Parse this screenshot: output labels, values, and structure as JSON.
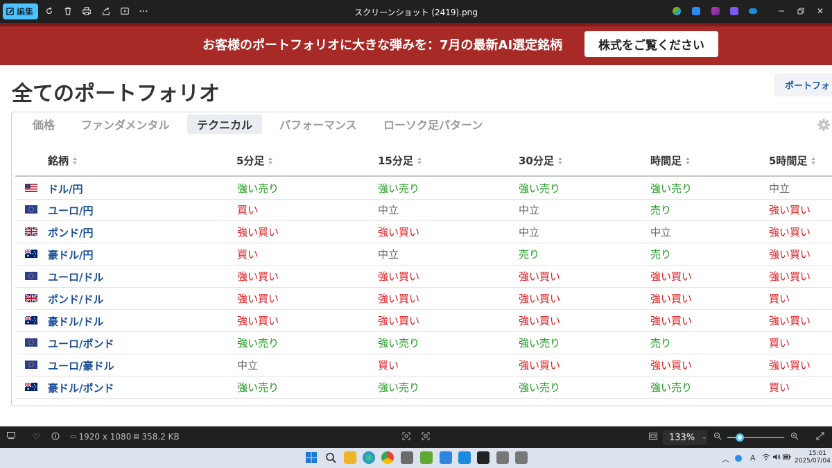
{
  "window": {
    "title": "スクリーンショット (2419).png",
    "edit_label": "編集",
    "toolbar_icons": [
      "rotate-icon",
      "delete-icon",
      "print-icon",
      "share-icon",
      "slideshow-icon",
      "more-icon"
    ],
    "window_controls": [
      "minimize-icon",
      "restore-icon",
      "close-icon"
    ]
  },
  "banner": {
    "text": "お客様のポートフォリオに大きな弾みを：7月の最新AI選定銘柄",
    "cta_label": "株式をご覧ください",
    "background_color": "#a72a27"
  },
  "page": {
    "title": "全てのポートフォリオ",
    "right_button_label": "ポートフォ"
  },
  "tabs": [
    {
      "label": "価格",
      "active": false
    },
    {
      "label": "ファンダメンタル",
      "active": false
    },
    {
      "label": "テクニカル",
      "active": true
    },
    {
      "label": "パフォーマンス",
      "active": false
    },
    {
      "label": "ローソク足パターン",
      "active": false
    }
  ],
  "table": {
    "columns": [
      "銘柄",
      "5分足",
      "15分足",
      "30分足",
      "時間足",
      "5時間足"
    ],
    "signal_colors": {
      "sell": "#1e9b1e",
      "buy": "#e0191c",
      "neutral": "#666666"
    },
    "rows": [
      {
        "flag": "us",
        "pair": "ドル/円",
        "signals": [
          {
            "text": "強い売り",
            "kind": "sell"
          },
          {
            "text": "強い売り",
            "kind": "sell"
          },
          {
            "text": "強い売り",
            "kind": "sell"
          },
          {
            "text": "強い売り",
            "kind": "sell"
          },
          {
            "text": "中立",
            "kind": "neutral"
          }
        ]
      },
      {
        "flag": "eu",
        "pair": "ユーロ/円",
        "signals": [
          {
            "text": "買い",
            "kind": "buy"
          },
          {
            "text": "中立",
            "kind": "neutral"
          },
          {
            "text": "中立",
            "kind": "neutral"
          },
          {
            "text": "売り",
            "kind": "sell"
          },
          {
            "text": "強い買い",
            "kind": "buy"
          }
        ]
      },
      {
        "flag": "gb",
        "pair": "ポンド/円",
        "signals": [
          {
            "text": "強い買い",
            "kind": "buy"
          },
          {
            "text": "強い買い",
            "kind": "buy"
          },
          {
            "text": "中立",
            "kind": "neutral"
          },
          {
            "text": "中立",
            "kind": "neutral"
          },
          {
            "text": "強い買い",
            "kind": "buy"
          }
        ]
      },
      {
        "flag": "au",
        "pair": "豪ドル/円",
        "signals": [
          {
            "text": "買い",
            "kind": "buy"
          },
          {
            "text": "中立",
            "kind": "neutral"
          },
          {
            "text": "売り",
            "kind": "sell"
          },
          {
            "text": "売り",
            "kind": "sell"
          },
          {
            "text": "強い買い",
            "kind": "buy"
          }
        ]
      },
      {
        "flag": "eu",
        "pair": "ユーロ/ドル",
        "signals": [
          {
            "text": "強い買い",
            "kind": "buy"
          },
          {
            "text": "強い買い",
            "kind": "buy"
          },
          {
            "text": "強い買い",
            "kind": "buy"
          },
          {
            "text": "強い買い",
            "kind": "buy"
          },
          {
            "text": "強い買い",
            "kind": "buy"
          }
        ]
      },
      {
        "flag": "gb",
        "pair": "ポンド/ドル",
        "signals": [
          {
            "text": "強い買い",
            "kind": "buy"
          },
          {
            "text": "強い買い",
            "kind": "buy"
          },
          {
            "text": "強い買い",
            "kind": "buy"
          },
          {
            "text": "強い買い",
            "kind": "buy"
          },
          {
            "text": "買い",
            "kind": "buy"
          }
        ]
      },
      {
        "flag": "au",
        "pair": "豪ドル/ドル",
        "signals": [
          {
            "text": "強い買い",
            "kind": "buy"
          },
          {
            "text": "強い買い",
            "kind": "buy"
          },
          {
            "text": "強い買い",
            "kind": "buy"
          },
          {
            "text": "強い買い",
            "kind": "buy"
          },
          {
            "text": "強い買い",
            "kind": "buy"
          }
        ]
      },
      {
        "flag": "eu",
        "pair": "ユーロ/ポンド",
        "signals": [
          {
            "text": "強い売り",
            "kind": "sell"
          },
          {
            "text": "強い売り",
            "kind": "sell"
          },
          {
            "text": "強い売り",
            "kind": "sell"
          },
          {
            "text": "売り",
            "kind": "sell"
          },
          {
            "text": "買い",
            "kind": "buy"
          }
        ]
      },
      {
        "flag": "eu",
        "pair": "ユーロ/豪ドル",
        "signals": [
          {
            "text": "中立",
            "kind": "neutral"
          },
          {
            "text": "買い",
            "kind": "buy"
          },
          {
            "text": "強い買い",
            "kind": "buy"
          },
          {
            "text": "強い買い",
            "kind": "buy"
          },
          {
            "text": "強い買い",
            "kind": "buy"
          }
        ]
      },
      {
        "flag": "au",
        "pair": "豪ドル/ポンド",
        "signals": [
          {
            "text": "強い売り",
            "kind": "sell"
          },
          {
            "text": "強い売り",
            "kind": "sell"
          },
          {
            "text": "強い売り",
            "kind": "sell"
          },
          {
            "text": "強い売り",
            "kind": "sell"
          },
          {
            "text": "買い",
            "kind": "buy"
          }
        ]
      }
    ]
  },
  "statusbar": {
    "dimensions": "1920 x 1080",
    "file_size": "358.2 KB",
    "zoom": "133%",
    "zoom_fraction": 0.22
  },
  "taskbar": {
    "time": "15:01",
    "date": "2025/07/04",
    "ime_label": "A"
  }
}
